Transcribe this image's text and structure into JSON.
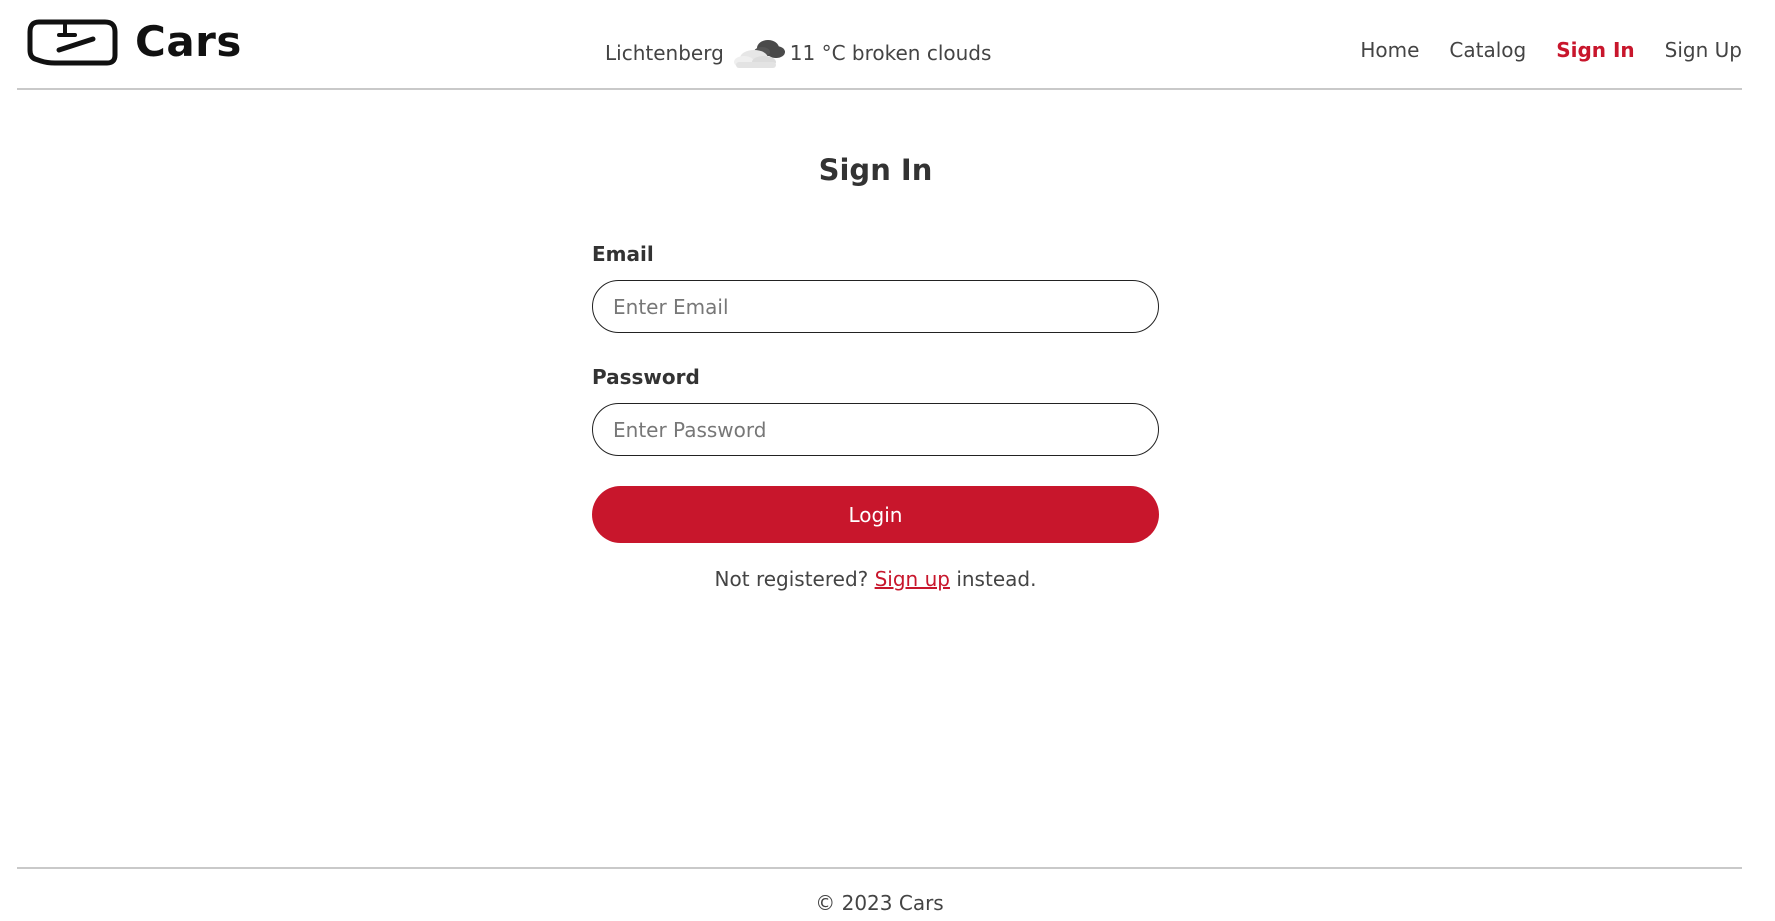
{
  "header": {
    "brand_name": "Cars",
    "brand_icon": "car-windshield-icon",
    "weather": {
      "city": "Lichtenberg",
      "icon": "broken-clouds-icon",
      "temperature": "11 °C",
      "description": "broken clouds"
    },
    "nav": {
      "home": "Home",
      "catalog": "Catalog",
      "sign_in": "Sign In",
      "sign_up": "Sign Up",
      "active": "Sign In"
    }
  },
  "main": {
    "title": "Sign In",
    "email": {
      "label": "Email",
      "placeholder": "Enter Email",
      "value": ""
    },
    "password": {
      "label": "Password",
      "placeholder": "Enter Password",
      "value": ""
    },
    "login_label": "Login",
    "signup_prompt": {
      "before": "Not registered?",
      "link": "Sign up",
      "after": "instead."
    }
  },
  "footer": {
    "copyright": "© 2023 Cars"
  },
  "colors": {
    "accent": "#c8162c",
    "text": "#333333",
    "divider": "#c9c9c9"
  }
}
